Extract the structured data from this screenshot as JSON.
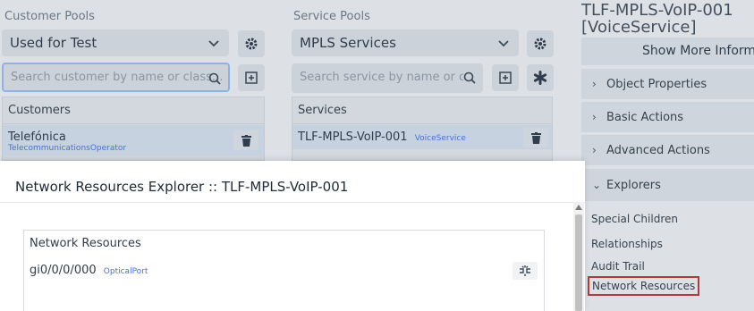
{
  "customer_pools": {
    "label": "Customer Pools",
    "selected": "Used for Test",
    "search_placeholder": "Search customer by name or class...",
    "list_header": "Customers",
    "items": [
      {
        "name": "Telefónica",
        "class": "TelecommunicationsOperator"
      }
    ]
  },
  "service_pools": {
    "label": "Service Pools",
    "selected": "MPLS Services",
    "search_placeholder": "Search service by name or cla",
    "list_header": "Services",
    "items": [
      {
        "name": "TLF-MPLS-VoIP-001",
        "class": "VoiceService"
      }
    ]
  },
  "right_panel": {
    "title_line1": "TLF-MPLS-VoIP-001",
    "title_line2": "[VoiceService]",
    "show_more": "Show More Informa",
    "sections": [
      {
        "label": "Object Properties",
        "arrow": "›"
      },
      {
        "label": "Basic Actions",
        "arrow": "›"
      },
      {
        "label": "Advanced Actions",
        "arrow": "›"
      },
      {
        "label": "Explorers",
        "arrow": "⌄"
      }
    ],
    "explorers": [
      "Special Children",
      "Relationships",
      "Audit Trail",
      "Network Resources"
    ]
  },
  "modal": {
    "title": "Network Resources Explorer :: TLF-MPLS-VoIP-001",
    "section_title": "Network Resources",
    "items": [
      {
        "name": "gi0/0/0/000",
        "class": "OpticalPort"
      }
    ]
  },
  "colors": {
    "accent_blue": "#4b6fd9",
    "highlight_border": "#b03a3a",
    "focus_border": "#8fb2e6"
  }
}
